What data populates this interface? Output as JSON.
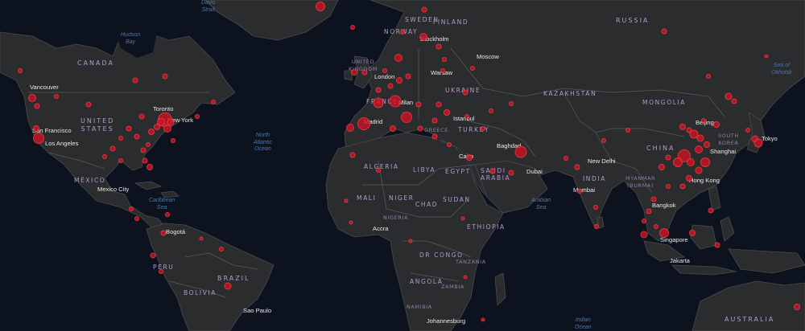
{
  "colors": {
    "ocean": "#0c121e",
    "land": "#2b2c2e",
    "bubble": "#d21222",
    "country_label": "#b39ad0",
    "city_label": "#e8e8e8",
    "ocean_label": "#4f78a8"
  },
  "countries": {
    "canada": "CANADA",
    "united_states": "UNITED\nSTATES",
    "mexico": "MÉXICO",
    "russia": "RUSSIA",
    "sweden": "SWEDEN",
    "finland": "FINLAND",
    "norway": "NORWAY",
    "united_kingdom": "UNITED\nKINGDOM",
    "france": "FRANCE",
    "ukraine": "UKRAINE",
    "kazakhstan": "KAZAKHSTAN",
    "mongolia": "MONGOLIA",
    "china": "CHINA",
    "south_korea": "SOUTH\nKOREA",
    "turkey": "TURKEY",
    "greece": "GREECE",
    "egypt": "EGYPT",
    "algeria": "ALGERIA",
    "libya": "LIBYA",
    "mali": "MALI",
    "niger": "NIGER",
    "chad": "CHAD",
    "sudan": "SUDAN",
    "nigeria": "NIGERIA",
    "ethiopia": "ETHIOPIA",
    "dr_congo": "DR CONGO",
    "tanzania": "TANZANIA",
    "angola": "ANGOLA",
    "zambia": "ZAMBIA",
    "namibia": "NAMIBIA",
    "saudi_arabia": "SAUDI\nARABIA",
    "india": "INDIA",
    "myanmar": "MYANMAR\n(BURMA)",
    "peru": "PERU",
    "brazil": "BRAZIL",
    "bolivia": "BOLIVIA",
    "australia": "AUSTRALIA"
  },
  "cities": {
    "vancouver": "Vancouver",
    "toronto": "Toronto",
    "new_york": "New York",
    "san_francisco": "San Francisco",
    "los_angeles": "Los Angeles",
    "mexico_city": "Mexico City",
    "bogota": "Bogotá",
    "sao_paulo": "Sao Paulo",
    "london": "London",
    "madrid": "Madrid",
    "milan": "Milan",
    "stockholm": "Stockholm",
    "moscow": "Moscow",
    "warsaw": "Warsaw",
    "istanbul": "Istanbul",
    "cairo": "Cairo",
    "baghdad": "Baghdad",
    "dubai": "Dubai",
    "new_delhi": "New Delhi",
    "mumbai": "Mumbai",
    "beijing": "Beijing",
    "shanghai": "Shanghai",
    "tokyo": "Tokyo",
    "hong_kong": "Hong Kong",
    "bangkok": "Bangkok",
    "singapore": "Singapore",
    "jakarta": "Jakarta",
    "accra": "Accra",
    "johannesburg": "Johannesburg"
  },
  "oceans": {
    "hudson_bay": "Hudson\nBay",
    "davis_strait": "Davis\nStrait",
    "north_atlantic": "North\nAtlantic\nOcean",
    "caribbean": "Caribbean\nSea",
    "arabian_sea": "Arabian\nSea",
    "indian_ocean": "Indian\nOcean",
    "sea_of_okhotsk": "Sea of\nOkhotsk"
  }
}
